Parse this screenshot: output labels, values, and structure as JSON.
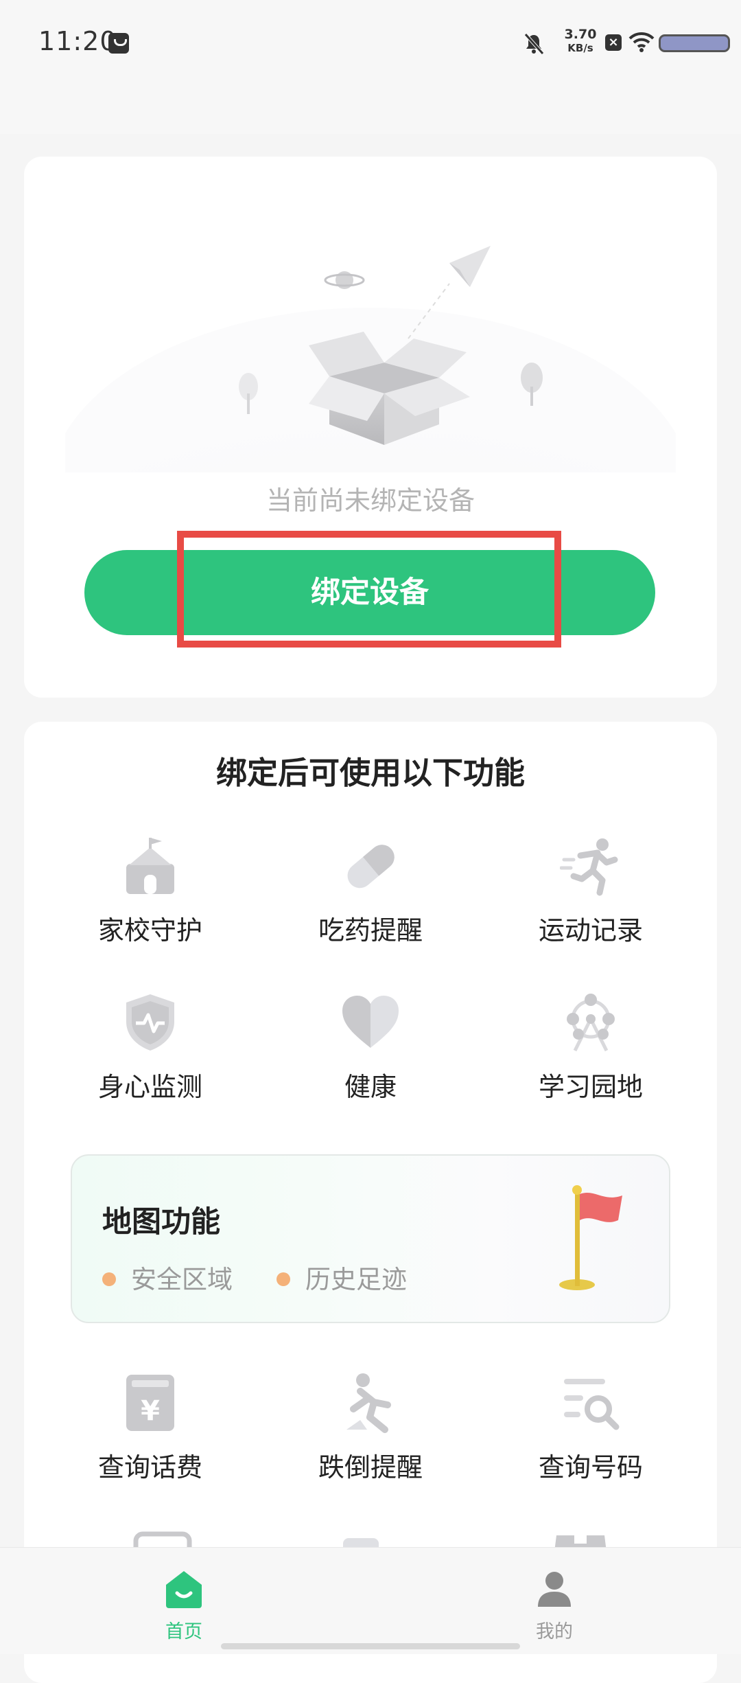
{
  "status_bar": {
    "time": "11:20",
    "net_speed_value": "3.70",
    "net_speed_unit": "KB/s"
  },
  "device_card": {
    "empty_text": "当前尚未绑定设备",
    "bind_button": "绑定设备"
  },
  "features": {
    "title": "绑定后可使用以下功能",
    "items": [
      {
        "label": "家校守护",
        "icon": "school-icon"
      },
      {
        "label": "吃药提醒",
        "icon": "pill-icon"
      },
      {
        "label": "运动记录",
        "icon": "running-icon"
      },
      {
        "label": "身心监测",
        "icon": "shield-heartbeat-icon"
      },
      {
        "label": "健康",
        "icon": "heart-icon"
      },
      {
        "label": "学习园地",
        "icon": "ferris-wheel-icon"
      }
    ],
    "map": {
      "title": "地图功能",
      "tags": [
        "安全区域",
        "历史足迹"
      ]
    },
    "items2": [
      {
        "label": "查询话费",
        "icon": "yuan-bill-icon"
      },
      {
        "label": "跌倒提醒",
        "icon": "fall-person-icon"
      },
      {
        "label": "查询号码",
        "icon": "search-list-icon"
      }
    ]
  },
  "bottom_nav": {
    "home": "首页",
    "mine": "我的"
  },
  "colors": {
    "accent": "#2ec47e",
    "highlight": "#e84b45",
    "icon_gray": "#c9c9cc"
  }
}
